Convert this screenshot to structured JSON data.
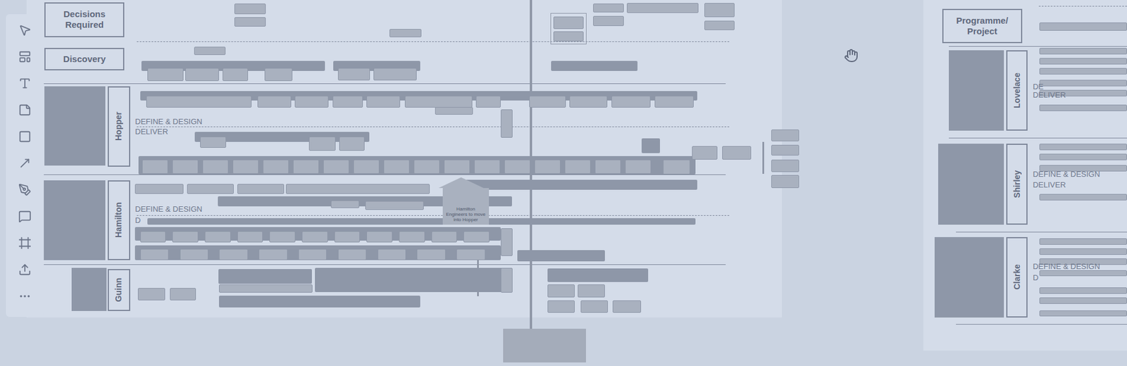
{
  "board": {
    "headers": [
      "Decisions Required",
      "Discovery"
    ],
    "lanes": [
      {
        "name": "Hopper",
        "phases": [
          "DEFINE & DESIGN",
          "DELIVER"
        ]
      },
      {
        "name": "Hamilton",
        "phases": [
          "DEFINE & DESIGN",
          "D"
        ]
      },
      {
        "name": "Guinn",
        "phases": []
      }
    ],
    "callout": "Hamilton Engineers to move into Hopper"
  },
  "side_board": {
    "header": "Programme/ Project",
    "lanes": [
      {
        "name": "Lovelace",
        "phases": [
          "DE",
          "DELIVER"
        ]
      },
      {
        "name": "Shirley",
        "phases": [
          "DEFINE & DESIGN",
          "DELIVER"
        ]
      },
      {
        "name": "Clarke",
        "phases": [
          "DEFINE & DESIGN",
          "D"
        ]
      }
    ]
  }
}
